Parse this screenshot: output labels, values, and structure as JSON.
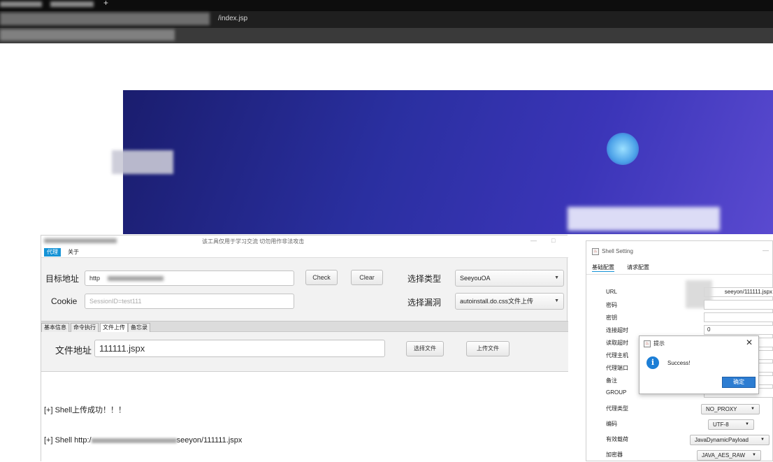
{
  "browser": {
    "new_tab": "+",
    "url_text": "/index.jsp"
  },
  "tool": {
    "title": "该工具仅用于学习交流 切勿用作非法攻击",
    "win_min": "—",
    "win_max": "□",
    "menu": [
      "代理",
      "关于"
    ],
    "target_label": "目标地址",
    "target_value": "http",
    "cookie_label": "Cookie",
    "cookie_placeholder": "SessionID=test111",
    "check_btn": "Check",
    "clear_btn": "Clear",
    "type_label": "选择类型",
    "type_value": "SeeyouOA",
    "vuln_label": "选择漏洞",
    "vuln_value": "autoinstall.do.css文件上传",
    "tabs": [
      "基本信息",
      "命令执行",
      "文件上传",
      "备忘录"
    ],
    "file_label": "文件地址",
    "file_value": "111111.jspx",
    "choose_file_btn": "选择文件",
    "upload_btn": "上传文件",
    "output": [
      "[+] Shell上传成功！！！",
      "[+] Shell http:/",
      "seeyon/111111.jspx"
    ]
  },
  "shell": {
    "title": "Shell Setting",
    "win_min": "—",
    "tabs": [
      "基础配置",
      "请求配置"
    ],
    "rows": [
      "URL",
      "密码",
      "密钥",
      "连接超时",
      "读取超时",
      "代理主机",
      "代理端口",
      "备注",
      "GROUP",
      "代理类型",
      "编码",
      "有效载荷",
      "加密器"
    ],
    "url_value": "seeyon/111111.jspx",
    "timeout_value": "0",
    "group_value": "/",
    "proxy_type": "NO_PROXY",
    "encoding": "UTF-8",
    "payload": "JavaDynamicPayload",
    "cryption": "JAVA_AES_RAW"
  },
  "dialog": {
    "title": "提示",
    "close": "✕",
    "info_glyph": "i",
    "message": "Success!",
    "ok": "确定"
  },
  "icons": {
    "dropdown": "▼",
    "java": "♨"
  }
}
